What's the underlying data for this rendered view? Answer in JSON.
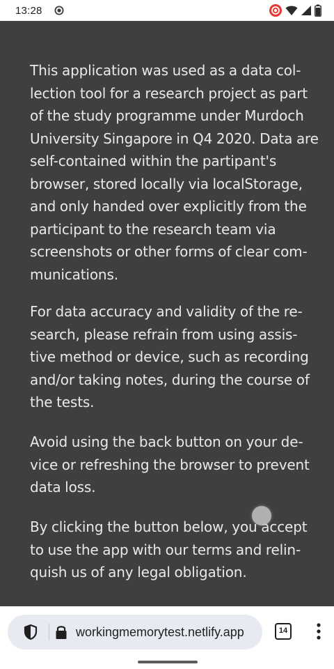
{
  "status_bar": {
    "time": "13:28",
    "left_icon": "screen-record-icon",
    "right_icons": [
      "recording-indicator-icon",
      "wifi-icon",
      "signal-icon",
      "battery-icon"
    ]
  },
  "content": {
    "paragraphs": [
      [
        "This application was used as a data col-",
        "lection tool for a research project as part",
        "of the study programme under Murdoch",
        "University Singapore in Q4 2020. Data are",
        "self-contained within the partipant's",
        "browser, stored locally via localStorage,",
        "and only handed over explicitly from the",
        "participant to the research team via",
        "screenshots or other forms of clear com-",
        "munications."
      ],
      [
        "For data accuracy and validity of the re-",
        "search, please refrain from using assis-",
        "tive method or device, such as recording",
        "and/or taking notes, during the course of",
        "the tests."
      ],
      [
        "Avoid using the back button on your de-",
        "vice or refreshing the browser to prevent",
        "data loss."
      ],
      [
        "By clicking the button below, you accept",
        "to use the app with our terms and relin-",
        "quish us of any legal obligation."
      ]
    ]
  },
  "browser": {
    "url": "workingmemorytest.netlify.app",
    "tab_count": "14",
    "icons": {
      "site_info": "shield-icon",
      "security": "lock-icon",
      "menu": "more-vert-icon"
    }
  },
  "colors": {
    "page_background": "#3f3f3f",
    "text": "#e9e9e9",
    "recording_indicator": "#e53935"
  }
}
